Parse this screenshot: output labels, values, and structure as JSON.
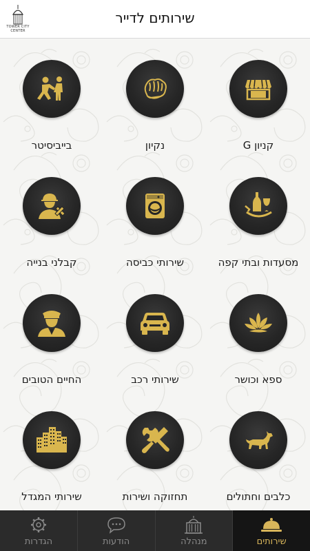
{
  "header": {
    "title": "שירותים לדייר",
    "logo_line1": "TOWER CITY",
    "logo_line2": "CENTER"
  },
  "services": [
    {
      "label": "קניון G",
      "icon": "storefront-icon"
    },
    {
      "label": "נקיון",
      "icon": "cleaning-sponge-icon"
    },
    {
      "label": "בייביסיטר",
      "icon": "babysitter-icon"
    },
    {
      "label": "מסעדות ובתי קפה",
      "icon": "restaurant-bottle-icon"
    },
    {
      "label": "שירותי כביסה",
      "icon": "washing-machine-icon"
    },
    {
      "label": "קבלני בנייה",
      "icon": "construction-worker-icon"
    },
    {
      "label": "ספא וכושר",
      "icon": "lotus-icon"
    },
    {
      "label": "שירותי רכב",
      "icon": "car-icon"
    },
    {
      "label": "החיים הטובים",
      "icon": "doorman-icon"
    },
    {
      "label": "כלבים וחתולים",
      "icon": "dog-icon"
    },
    {
      "label": "תחזוקה ושירות",
      "icon": "tools-icon"
    },
    {
      "label": "שירותי המגדל",
      "icon": "buildings-icon"
    }
  ],
  "tabs": [
    {
      "label": "הגדרות",
      "icon": "gear-icon",
      "active": false
    },
    {
      "label": "הודעות",
      "icon": "chat-bubble-icon",
      "active": false
    },
    {
      "label": "מנהלה",
      "icon": "building-dome-icon",
      "active": false
    },
    {
      "label": "שירותים",
      "icon": "service-bell-icon",
      "active": true
    }
  ],
  "colors": {
    "gold": "#d9b64e",
    "circle": "#262626",
    "tabbar": "#2b2b2b",
    "active_label": "#d8b55a"
  }
}
